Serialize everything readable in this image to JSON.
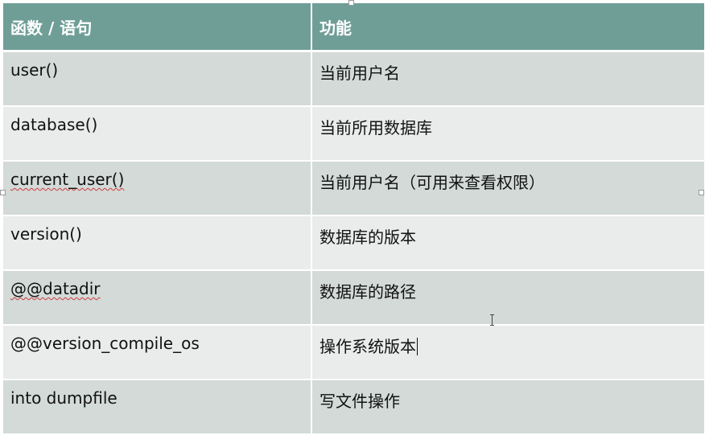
{
  "table": {
    "header": [
      "函数 / 语句",
      "功能"
    ],
    "rows": [
      {
        "func": "user()",
        "desc": "当前用户名"
      },
      {
        "func": "database()",
        "desc": "当前所用数据库"
      },
      {
        "func": "current_user()",
        "desc": "当前用户名（可用来查看权限）"
      },
      {
        "func": "version()",
        "desc": "数据库的版本"
      },
      {
        "func": "@@datadir",
        "desc": "数据库的路径"
      },
      {
        "func": "@@version_compile_os",
        "desc": "操作系统版本"
      },
      {
        "func": "into dumpfile",
        "desc": "写文件操作"
      }
    ]
  },
  "colors": {
    "header_bg": "#6f9e97",
    "row_odd": "#d3dad8",
    "row_even": "#e9eceb"
  }
}
